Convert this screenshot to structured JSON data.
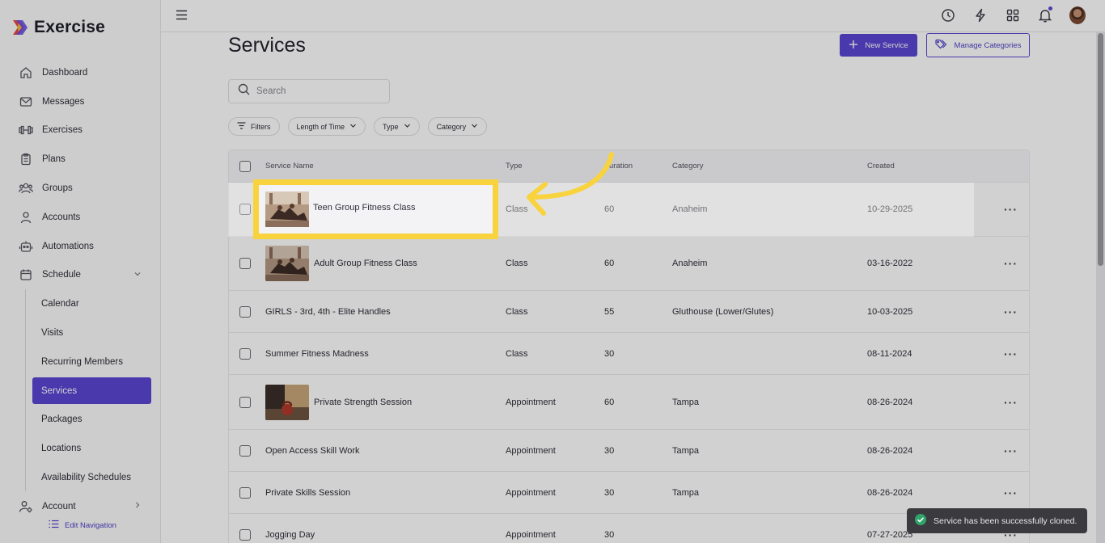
{
  "app": {
    "name": "Exercise"
  },
  "sidebar": {
    "items": [
      {
        "label": "Dashboard",
        "icon": "home-icon"
      },
      {
        "label": "Messages",
        "icon": "mail-icon"
      },
      {
        "label": "Exercises",
        "icon": "dumbbell-icon"
      },
      {
        "label": "Plans",
        "icon": "clipboard-icon"
      },
      {
        "label": "Groups",
        "icon": "users-icon"
      },
      {
        "label": "Accounts",
        "icon": "user-icon"
      },
      {
        "label": "Automations",
        "icon": "robot-icon"
      },
      {
        "label": "Schedule",
        "icon": "calendar-icon"
      }
    ],
    "schedule_sub": [
      "Calendar",
      "Visits",
      "Recurring Members",
      "Services",
      "Packages",
      "Locations",
      "Availability Schedules"
    ],
    "active": "Services",
    "account_label": "Account",
    "edit_nav_label": "Edit Navigation"
  },
  "header": {
    "title": "Services",
    "new_button": "New Service",
    "manage_button": "Manage Categories"
  },
  "search": {
    "placeholder": "Search"
  },
  "filters": [
    "Filters",
    "Length of Time",
    "Type",
    "Category"
  ],
  "table": {
    "columns": [
      "Service Name",
      "Type",
      "Duration",
      "Category",
      "Created"
    ],
    "duration_header_visible": "uration",
    "rows": [
      {
        "name": "Teen Group Fitness Class",
        "type": "Class",
        "duration": "60",
        "category": "Anaheim",
        "created": "10-29-2025",
        "thumb": "fitness"
      },
      {
        "name": "Adult Group Fitness Class",
        "type": "Class",
        "duration": "60",
        "category": "Anaheim",
        "created": "03-16-2022",
        "thumb": "fitness"
      },
      {
        "name": "GIRLS - 3rd, 4th - Elite Handles",
        "type": "Class",
        "duration": "55",
        "category": "Gluthouse (Lower/Glutes)",
        "created": "10-03-2025",
        "thumb": ""
      },
      {
        "name": "Summer Fitness Madness",
        "type": "Class",
        "duration": "30",
        "category": "",
        "created": "08-11-2024",
        "thumb": ""
      },
      {
        "name": "Private Strength Session",
        "type": "Appointment",
        "duration": "60",
        "category": "Tampa",
        "created": "08-26-2024",
        "thumb": "kettlebell"
      },
      {
        "name": "Open Access Skill Work",
        "type": "Appointment",
        "duration": "30",
        "category": "Tampa",
        "created": "08-26-2024",
        "thumb": ""
      },
      {
        "name": "Private Skills Session",
        "type": "Appointment",
        "duration": "30",
        "category": "Tampa",
        "created": "08-26-2024",
        "thumb": ""
      },
      {
        "name": "Jogging Day",
        "type": "Appointment",
        "duration": "30",
        "category": "",
        "created": "07-27-2025",
        "thumb": ""
      }
    ]
  },
  "toast": {
    "message": "Service has been successfully cloned."
  },
  "colors": {
    "accent": "#5b46d3",
    "highlight": "#f8d33e"
  }
}
